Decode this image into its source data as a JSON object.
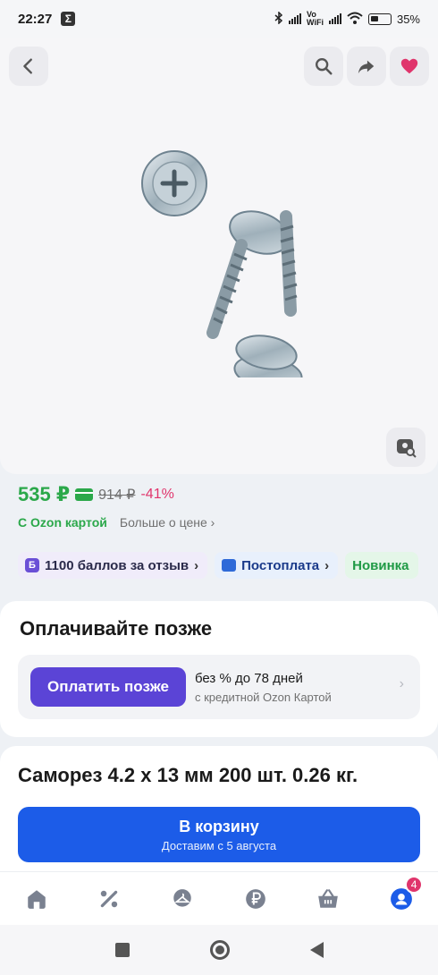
{
  "status_bar": {
    "time": "22:27",
    "battery": "35%"
  },
  "price": {
    "current": "535 ₽",
    "old": "914 ₽",
    "discount": "-41%",
    "card_label": "С Ozon картой",
    "more_label": "Больше о цене",
    "accent_color": "#2ba84a",
    "discount_color": "#e0356c"
  },
  "chips": [
    {
      "label": "1100 баллов за отзыв",
      "icon": "points-icon"
    },
    {
      "label": "Постоплата",
      "icon": "postpay-icon"
    },
    {
      "label": "Новинка",
      "icon": ""
    }
  ],
  "pay_later": {
    "title": "Оплачивайте позже",
    "button": "Оплатить позже",
    "line1": "без % до 78 дней",
    "line2": "с кредитной Ozon Картой"
  },
  "product": {
    "title": "Саморез 4.2 х 13 мм 200 шт. 0.26 кг.",
    "cart_button": "В корзину",
    "delivery": "Доставим с 5 августа"
  },
  "bottom_nav": {
    "items": [
      "home-icon",
      "percent-icon",
      "hanger-icon",
      "ruble-icon",
      "basket-icon",
      "profile-icon"
    ],
    "profile_badge": "4"
  }
}
